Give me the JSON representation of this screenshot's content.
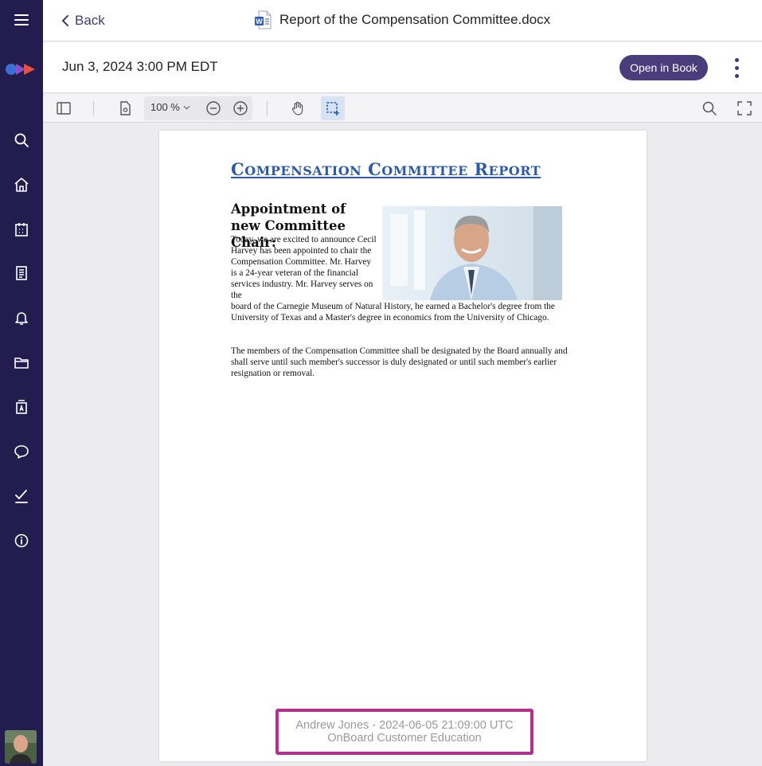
{
  "topbar": {
    "back_label": "Back",
    "document_title": "Report of the Compensation Committee.docx"
  },
  "meta": {
    "date": "Jun 3, 2024 3:00 PM EDT",
    "open_in_book_label": "Open in Book"
  },
  "toolbar": {
    "zoom_value": "100 %"
  },
  "sidebar": {
    "items": [
      "menu-icon",
      "search-icon",
      "home-icon",
      "calendar-icon",
      "book-icon",
      "bell-icon",
      "folder-icon",
      "directory-icon",
      "chat-icon",
      "tasks-icon",
      "info-icon"
    ]
  },
  "document": {
    "heading_first": "C",
    "heading_first_rest": "OMPENSATION",
    "heading_second": "C",
    "heading_second_rest": "OMMITTEE",
    "heading_third": "R",
    "heading_third_rest": "EPORT",
    "subheading": "Appointment of new Committee Chair:",
    "para1_narrow": "Today, we are excited to announce Cecil Harvey has been appointed to chair the Compensation Committee. Mr. Harvey is a 24-year veteran of the financial services industry. Mr. Harvey serves on the",
    "para1_wide": "board of the Carnegie Museum of Natural History, he earned a Bachelor's degree from the University of Texas and a Master's degree in economics from the University of Chicago.",
    "para2": "The members of the Compensation Committee shall be designated by the Board annually and shall serve until such member's successor is duly designated or until such member's earlier resignation or removal."
  },
  "watermark": {
    "line1": "Andrew Jones - 2024-06-05 21:09:00 UTC",
    "line2": "OnBoard Customer Education"
  },
  "colors": {
    "sidebar_bg": "#221d4e",
    "accent": "#4a3d7c",
    "heading_blue": "#2d5aa7",
    "watermark_border": "#b3318c"
  }
}
